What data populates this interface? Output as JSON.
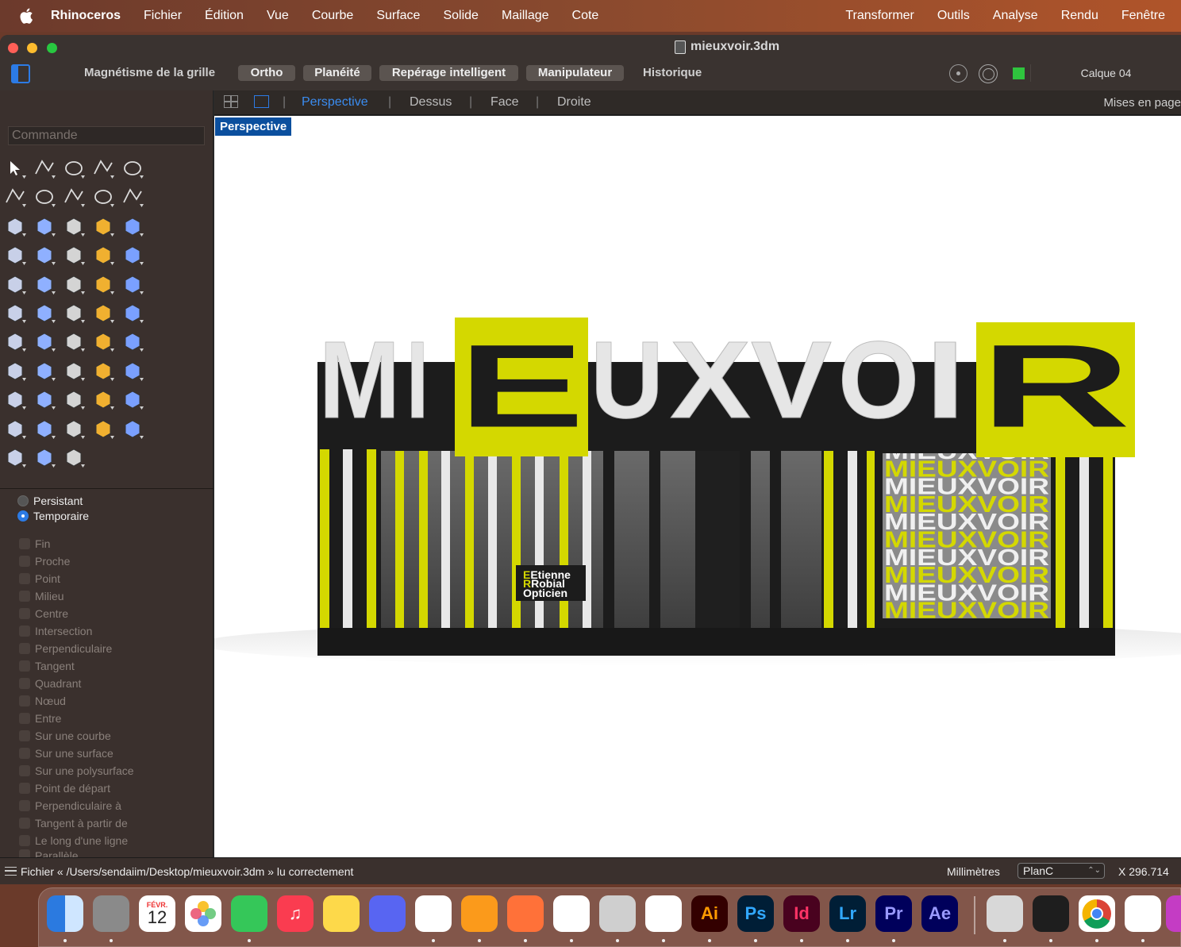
{
  "menubar": {
    "app": "Rhinoceros",
    "items": [
      "Fichier",
      "Édition",
      "Vue",
      "Courbe",
      "Surface",
      "Solide",
      "Maillage",
      "Cote"
    ],
    "right_items": [
      "Transformer",
      "Outils",
      "Analyse",
      "Rendu",
      "Fenêtre"
    ]
  },
  "window": {
    "title": "mieuxvoir.3dm"
  },
  "toolbar": {
    "grid_snap": "Magnétisme de la grille",
    "ortho": "Ortho",
    "planar": "Planéité",
    "smart_track": "Repérage intelligent",
    "gumball": "Manipulateur",
    "history": "Historique",
    "layer": "Calque 04",
    "layer_color": "#2fc43e"
  },
  "command": {
    "placeholder": "Commande"
  },
  "tool_icons": [
    "select-arrow-icon",
    "point-icon",
    "polyline-icon",
    "curve-icon",
    "circle-icon",
    "ellipse-icon",
    "arc-icon",
    "rectangle-icon",
    "polygon-icon",
    "fillet-curve-icon",
    "surface-corner-icon",
    "extrude-icon",
    "box-icon",
    "sphere-icon",
    "cylinder-icon",
    "plane-icon",
    "explode-icon",
    "split-icon",
    "trim-icon",
    "join-icon",
    "group-icon",
    "ungroup-icon",
    "move-icon",
    "rotate-icon",
    "text-icon",
    "scale-icon",
    "array-icon",
    "mirror-icon",
    "boolean-icon",
    "dimension-icon",
    "grid-array-icon",
    "orient-icon",
    "cube-icon",
    "check-icon",
    "solid-icon",
    "paint-icon",
    "zoom-icon",
    "zoom-window-icon",
    "zoom-extents-icon",
    "zoom-selected-icon",
    "camera-icon",
    "car-icon",
    "render-icon",
    "lights-icon",
    "bulb-icon",
    "lock-icon",
    "color-icon",
    "color-wheel-icon",
    "material-icon",
    "environment-icon",
    "sphere-blue-icon",
    "render-cone-icon",
    "layout-icon"
  ],
  "osnap": {
    "persistent": "Persistant",
    "temporary": "Temporaire",
    "items": [
      "Fin",
      "Proche",
      "Point",
      "Milieu",
      "Centre",
      "Intersection",
      "Perpendiculaire",
      "Tangent",
      "Quadrant",
      "Nœud",
      "Entre",
      "Sur une courbe",
      "Sur une surface",
      "Sur une polysurface",
      "Point de départ",
      "Perpendiculaire à",
      "Tangent à partir de",
      "Le long d'une ligne",
      "Parallèle"
    ]
  },
  "viewports": {
    "tabs": [
      "Perspective",
      "Dessus",
      "Face",
      "Droite"
    ],
    "active": "Perspective",
    "layouts": "Mises en page",
    "active_label": "Perspective"
  },
  "scene": {
    "sign_text": [
      "M",
      "I",
      "E",
      "U",
      "X",
      "V",
      "O",
      "I",
      "R"
    ],
    "shop_name": [
      "Etienne",
      "Robial",
      "Opticien"
    ],
    "shop_initials": [
      "E",
      "R"
    ],
    "window_text": "MIEUXVOIR",
    "accent_color": "#d4d800"
  },
  "statusbar": {
    "message": "Fichier « /Users/sendaiim/Desktop/mieuxvoir.3dm » lu correctement",
    "units": "Millimètres",
    "cplane": "PlanC",
    "coord": "X 296.714"
  },
  "dock": {
    "calendar_month": "FÉVR.",
    "calendar_day": "12",
    "apps": [
      {
        "name": "finder-icon",
        "label": "",
        "color": "#3a8ef0"
      },
      {
        "name": "system-settings-icon",
        "label": "",
        "color": "#8a8a8a"
      },
      {
        "name": "calendar-icon",
        "label": "",
        "color": "#ffffff"
      },
      {
        "name": "photos-icon",
        "label": "",
        "color": "#ffffff"
      },
      {
        "name": "messages-icon",
        "label": "",
        "color": "#35c759"
      },
      {
        "name": "music-icon",
        "label": "♫",
        "color": "#fa3c50"
      },
      {
        "name": "notes-icon",
        "label": "",
        "color": "#fdd94a"
      },
      {
        "name": "discord-icon",
        "label": "",
        "color": "#5865f2"
      },
      {
        "name": "vscode-icon",
        "label": "",
        "color": "#ffffff"
      },
      {
        "name": "pages-icon",
        "label": "",
        "color": "#fb9a1b"
      },
      {
        "name": "firefox-icon",
        "label": "",
        "color": "#ff7139"
      },
      {
        "name": "safari-icon",
        "label": "",
        "color": "#ffffff"
      },
      {
        "name": "disk-utility-icon",
        "label": "",
        "color": "#cfcfcf"
      },
      {
        "name": "acrobat-icon",
        "label": "",
        "color": "#ffffff"
      },
      {
        "name": "illustrator-icon",
        "label": "Ai",
        "color": "#330000"
      },
      {
        "name": "photoshop-icon",
        "label": "Ps",
        "color": "#001e36"
      },
      {
        "name": "indesign-icon",
        "label": "Id",
        "color": "#49021f"
      },
      {
        "name": "lightroom-icon",
        "label": "Lr",
        "color": "#001e36"
      },
      {
        "name": "premiere-icon",
        "label": "Pr",
        "color": "#00005b"
      },
      {
        "name": "after-effects-icon",
        "label": "Ae",
        "color": "#00005b"
      },
      {
        "name": "rhino-icon",
        "label": "",
        "color": "#d8d8d8"
      },
      {
        "name": "figma-icon",
        "label": "",
        "color": "#1e1e1e"
      },
      {
        "name": "chrome-icon",
        "label": "",
        "color": "#ffffff"
      },
      {
        "name": "visual-studio-icon",
        "label": "",
        "color": "#ffffff"
      },
      {
        "name": "app-partial-icon",
        "label": "",
        "color": "#c43cc4"
      }
    ]
  }
}
